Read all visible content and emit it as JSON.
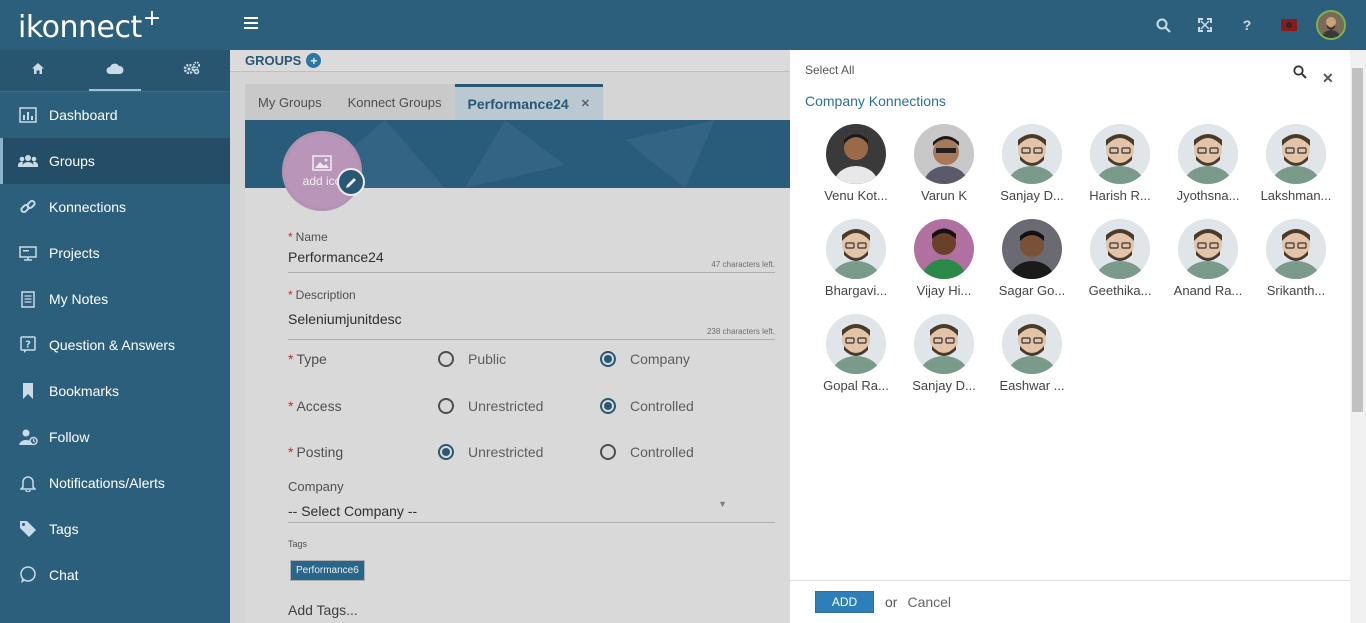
{
  "app": {
    "logo": "ikonnect",
    "logo_sup": "+"
  },
  "sidebar": {
    "tabs": [
      {
        "icon": "home-icon"
      },
      {
        "icon": "cloud-icon"
      },
      {
        "icon": "settings-gears-icon"
      }
    ],
    "items": [
      {
        "label": "Dashboard",
        "icon": "dashboard-icon"
      },
      {
        "label": "Groups",
        "icon": "groups-icon"
      },
      {
        "label": "Konnections",
        "icon": "link-icon"
      },
      {
        "label": "Projects",
        "icon": "projects-icon"
      },
      {
        "label": "My Notes",
        "icon": "notes-icon"
      },
      {
        "label": "Question & Answers",
        "icon": "question-icon"
      },
      {
        "label": "Bookmarks",
        "icon": "bookmark-icon"
      },
      {
        "label": "Follow",
        "icon": "follow-icon"
      },
      {
        "label": "Notifications/Alerts",
        "icon": "bell-icon"
      },
      {
        "label": "Tags",
        "icon": "tags-icon"
      },
      {
        "label": "Chat",
        "icon": "chat-icon"
      }
    ]
  },
  "topbar": {
    "help": "?"
  },
  "groups": {
    "header": "GROUPS",
    "tabs": [
      "My Groups",
      "Konnect Groups",
      "Performance24"
    ],
    "avatar_text": "add ico",
    "name_label": "Name",
    "name_value": "Performance24",
    "name_hint": "47 characters left.",
    "desc_label": "Description",
    "desc_value": "Seleniumjunitdesc",
    "desc_hint": "238 characters left.",
    "type_label": "Type",
    "type_opts": [
      "Public",
      "Company"
    ],
    "access_label": "Access",
    "access_opts": [
      "Unrestricted",
      "Controlled"
    ],
    "posting_label": "Posting",
    "posting_opts": [
      "Unrestricted",
      "Controlled"
    ],
    "company_label": "Company",
    "company_value": "-- Select Company --",
    "tags_label": "Tags",
    "tag_chip": "Performance6",
    "add_tags": "Add Tags..."
  },
  "panel": {
    "select_all": "Select All",
    "title": "Company Konnections",
    "people": [
      "Venu Kot...",
      "Varun K",
      "Sanjay D...",
      "Harish R...",
      "Jyothsna...",
      "Lakshman...",
      "Bhargavi...",
      "Vijay Hi...",
      "Sagar Go...",
      "Geethika...",
      "Anand Ra...",
      "Srikanth...",
      "Gopal Ra...",
      "Sanjay D...",
      "Eashwar ..."
    ],
    "add_label": "ADD",
    "or_label": "or",
    "cancel_label": "Cancel"
  }
}
